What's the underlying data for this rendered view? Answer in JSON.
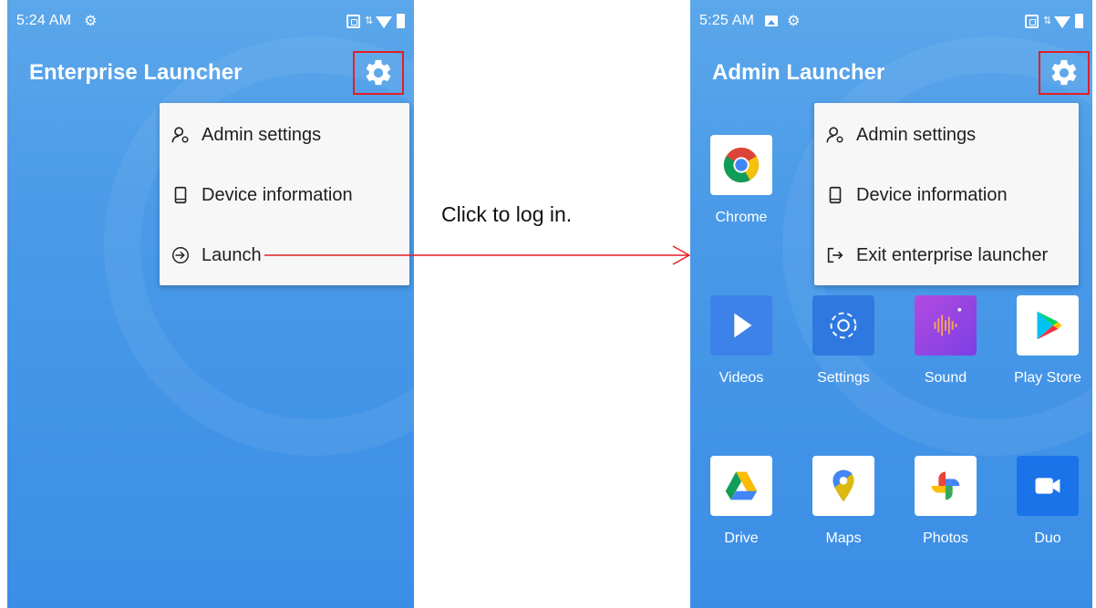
{
  "left_phone": {
    "status_time": "5:24 AM",
    "title": "Enterprise Launcher",
    "menu": [
      {
        "label": "Admin settings",
        "icon": "person-icon"
      },
      {
        "label": "Device information",
        "icon": "phone-icon"
      },
      {
        "label": "Launch",
        "icon": "enter-icon"
      }
    ]
  },
  "annotation": {
    "text": "Click to log in."
  },
  "right_phone": {
    "status_time": "5:25 AM",
    "title": "Admin Launcher",
    "menu": [
      {
        "label": "Admin settings",
        "icon": "person-icon"
      },
      {
        "label": "Device information",
        "icon": "phone-icon"
      },
      {
        "label": "Exit enterprise launcher",
        "icon": "exit-icon"
      }
    ],
    "apps": [
      {
        "label": "Chrome",
        "icon": "chrome-icon"
      },
      {
        "label": "Videos",
        "icon": "videos-icon"
      },
      {
        "label": "Settings",
        "icon": "settings-icon"
      },
      {
        "label": "Sound",
        "icon": "sound-icon"
      },
      {
        "label": "Play Store",
        "icon": "play-store-icon"
      },
      {
        "label": "Drive",
        "icon": "drive-icon"
      },
      {
        "label": "Maps",
        "icon": "maps-icon"
      },
      {
        "label": "Photos",
        "icon": "photos-icon"
      },
      {
        "label": "Duo",
        "icon": "duo-icon"
      }
    ]
  },
  "colors": {
    "highlight_box": "#e41e26",
    "annotation_arrow": "#e41e26",
    "background_blue": "#4a9ae8"
  }
}
